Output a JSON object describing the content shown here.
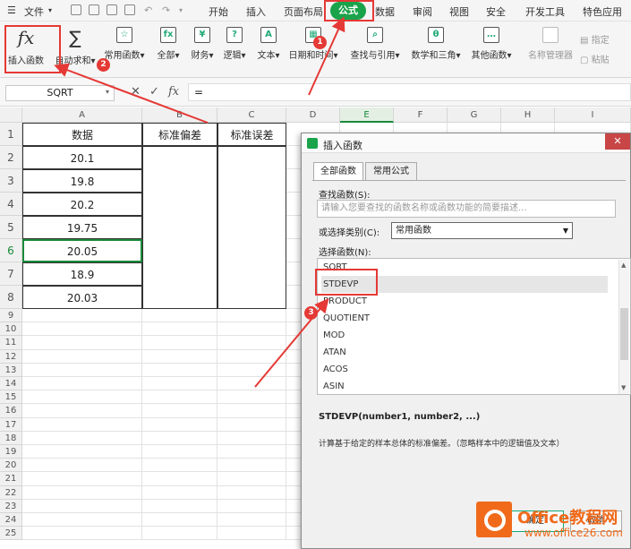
{
  "menubar": {
    "file_label": "文件",
    "tabs": [
      "开始",
      "插入",
      "页面布局",
      "公式",
      "数据",
      "审阅",
      "视图",
      "安全",
      "开发工具",
      "特色应用"
    ]
  },
  "ribbon": {
    "insert_function": "插入函数",
    "autosum": "自动求和",
    "common_functions": "常用函数",
    "all": "全部",
    "financial": "财务",
    "logical": "逻辑",
    "text": "文本",
    "datetime": "日期和时间",
    "lookup_reference": "查找与引用",
    "math_trig": "数学和三角",
    "other_functions": "其他函数",
    "name_manager": "名称管理器",
    "define_name": "指定",
    "paste": "粘贴"
  },
  "formula_bar": {
    "name_box": "SQRT",
    "fx": "fx",
    "value": "="
  },
  "grid": {
    "columns": [
      "A",
      "B",
      "C",
      "D",
      "E",
      "F",
      "G",
      "H",
      "I"
    ],
    "rows": [
      "1",
      "2",
      "3",
      "4",
      "5",
      "6",
      "7",
      "8",
      "9",
      "10",
      "11",
      "12",
      "13",
      "14",
      "15",
      "16",
      "17",
      "18",
      "19",
      "20",
      "21",
      "22",
      "23",
      "24",
      "25"
    ],
    "headers": [
      "数据",
      "标准偏差",
      "标准误差"
    ],
    "data": [
      "20.1",
      "19.8",
      "20.2",
      "19.75",
      "20.05",
      "18.9",
      "20.03"
    ]
  },
  "dialog": {
    "title": "插入函数",
    "tab_all": "全部函数",
    "tab_common": "常用公式",
    "search_label": "查找函数(S):",
    "search_placeholder": "请输入您要查找的函数名称或函数功能的简要描述...",
    "category_label": "或选择类别(C):",
    "category_value": "常用函数",
    "select_label": "选择函数(N):",
    "functions": [
      "SQRT",
      "STDEVP",
      "PRODUCT",
      "QUOTIENT",
      "MOD",
      "ATAN",
      "ACOS",
      "ASIN"
    ],
    "signature": "STDEVP(number1, number2, ...)",
    "description": "计算基于给定的样本总体的标准偏差。（忽略样本中的逻辑值及文本）",
    "ok": "确定",
    "cancel": "取消"
  },
  "annotations": {
    "badge1": "1",
    "badge2": "2",
    "badge3": "3",
    "color": "#e53935"
  },
  "watermark": {
    "brand": "Office教程网",
    "url": "www.office26.com"
  }
}
